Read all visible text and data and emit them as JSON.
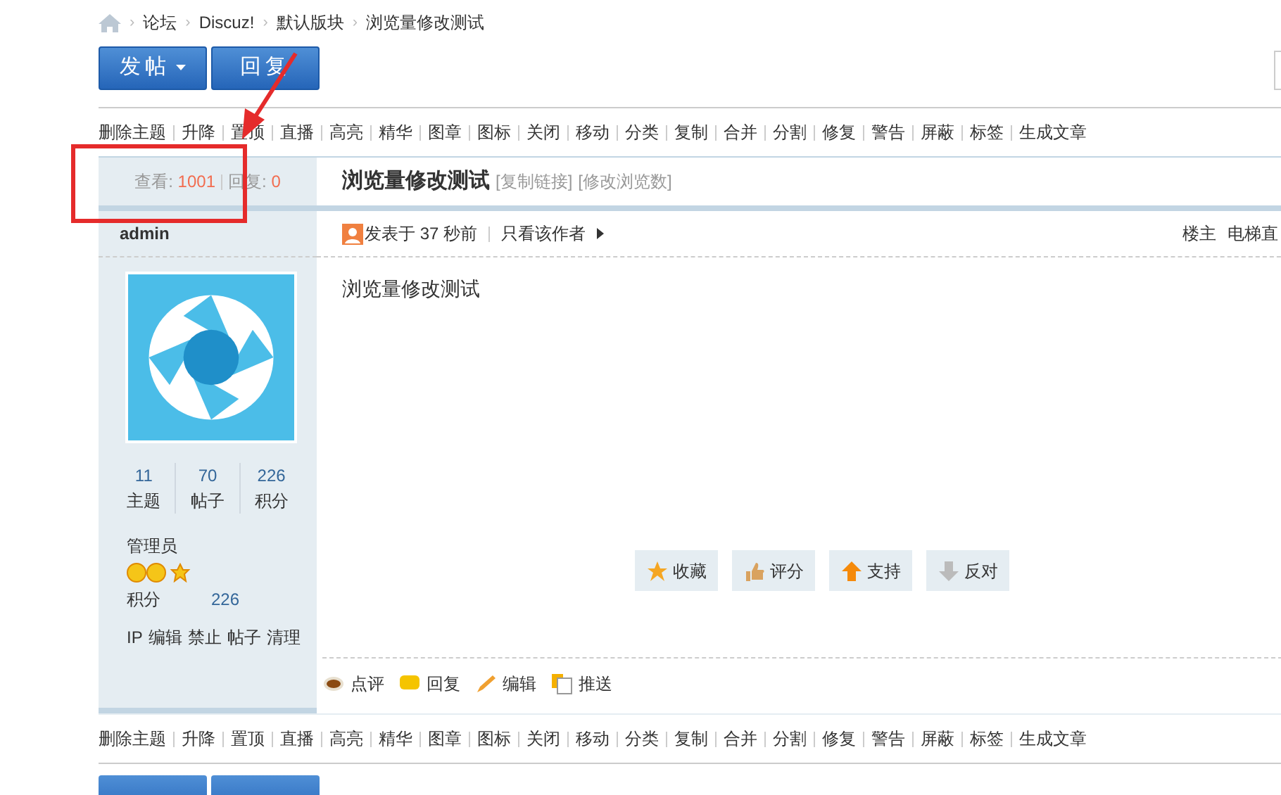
{
  "breadcrumb_separator": "›",
  "breadcrumbs": [
    "论坛",
    "Discuz!",
    "默认版块",
    "浏览量修改测试"
  ],
  "top_buttons": [
    {
      "label": "发帖",
      "kind": "dropdown"
    },
    {
      "label": "回复",
      "kind": "plain"
    }
  ],
  "top_toolbar": [
    "删除主题",
    "升降",
    "置顶",
    "直播",
    "高亮",
    "精华",
    "图章",
    "图标",
    "关闭",
    "移动",
    "分类",
    "复制",
    "合并",
    "分割",
    "修复",
    "警告",
    "屏蔽",
    "标签",
    "生成文章"
  ],
  "thread_stats": {
    "views_label": "查看:",
    "views": "1001",
    "replies_label": "回复:",
    "replies": "0"
  },
  "thread": {
    "title": "浏览量修改测试",
    "links": [
      "[复制链接]",
      "[修改浏览数]"
    ]
  },
  "author": {
    "name": "admin",
    "stats": [
      {
        "value": "11",
        "label": "主题"
      },
      {
        "value": "70",
        "label": "帖子"
      },
      {
        "value": "226",
        "label": "积分"
      }
    ],
    "group": "管理员",
    "points_label": "积分",
    "points": "226",
    "admin_links": [
      "IP",
      "编辑",
      "禁止",
      "帖子",
      "清理"
    ]
  },
  "post": {
    "posted": "发表于 37 秒前",
    "only_author": "只看该作者",
    "floor": "楼主",
    "jump": "电梯直",
    "body": "浏览量修改测试",
    "actions": [
      {
        "label": "收藏",
        "kind": "favorite"
      },
      {
        "label": "评分",
        "kind": "rate"
      },
      {
        "label": "支持",
        "kind": "support"
      },
      {
        "label": "反对",
        "kind": "oppose"
      }
    ],
    "footer": [
      {
        "label": "点评",
        "kind": "comment"
      },
      {
        "label": "回复",
        "kind": "reply"
      },
      {
        "label": "编辑",
        "kind": "edit"
      },
      {
        "label": "推送",
        "kind": "push"
      }
    ]
  },
  "bottom_toolbar": [
    "删除主题",
    "升降",
    "置顶",
    "直播",
    "高亮",
    "精华",
    "图章",
    "图标",
    "关闭",
    "移动",
    "分类",
    "复制",
    "合并",
    "分割",
    "修复",
    "警告",
    "屏蔽",
    "标签",
    "生成文章"
  ]
}
